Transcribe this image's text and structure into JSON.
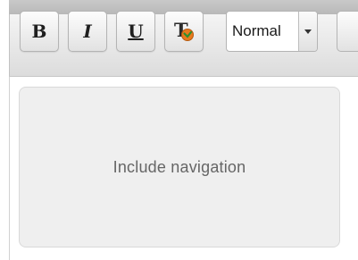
{
  "toolbar": {
    "buttons": [
      {
        "id": "bold",
        "glyph": "B",
        "icon": "bold-icon"
      },
      {
        "id": "italic",
        "glyph": "I",
        "icon": "italic-icon"
      },
      {
        "id": "underline",
        "glyph": "U",
        "icon": "underline-icon"
      },
      {
        "id": "clear_formatting",
        "glyph": "T",
        "icon": "clear-formatting-icon"
      }
    ],
    "format_select": {
      "value": "Normal",
      "arrow_icon": "caret-down-icon"
    }
  },
  "editor": {
    "widget_label": "Include navigation"
  },
  "colors": {
    "toolbar_bg": "#e6e6e6",
    "widget_bg": "#efefef",
    "widget_text": "#666666",
    "icon_accent_orange": "#e87a1e",
    "icon_accent_green": "#2f8f2f"
  }
}
